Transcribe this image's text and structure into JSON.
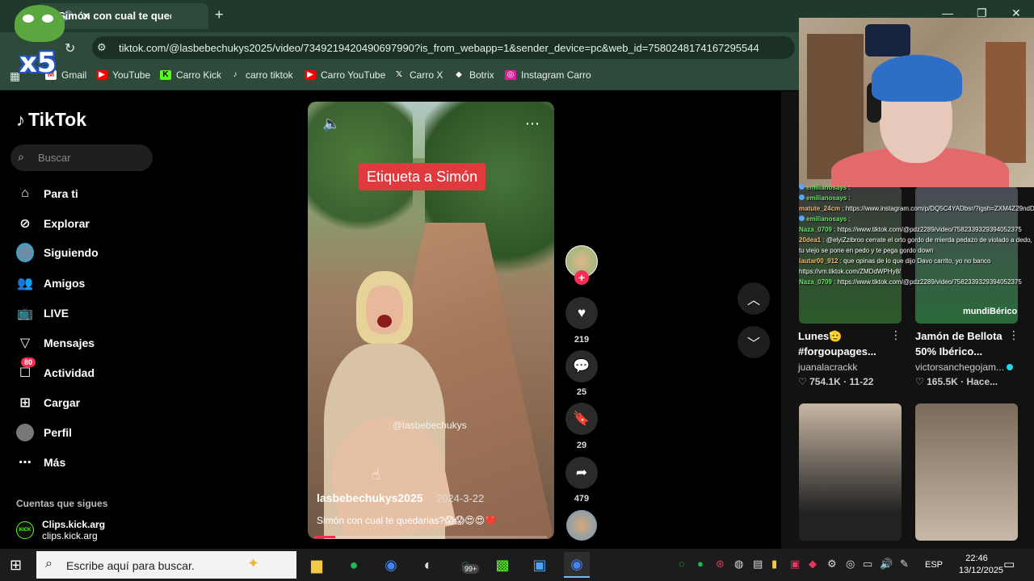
{
  "browser": {
    "tab_title": "Simón con cual te quedaría",
    "url": "tiktok.com/@lasbebechukys2025/video/7349219420490697990?is_from_webapp=1&sender_device=pc&web_id=7580248174167295544",
    "bookmarks": [
      "Gmail",
      "YouTube",
      "Carro Kick",
      "carro tiktok",
      "Carro YouTube",
      "Carro X",
      "Botrix",
      "Instagram Carro"
    ]
  },
  "overlay": {
    "emote_multiplier": "x5"
  },
  "tiktok": {
    "logo": "TikTok",
    "search_placeholder": "Buscar",
    "nav": [
      {
        "label": "Para ti",
        "icon": "home-icon"
      },
      {
        "label": "Explorar",
        "icon": "compass-icon"
      },
      {
        "label": "Siguiendo",
        "icon": "avatar"
      },
      {
        "label": "Amigos",
        "icon": "friends-icon"
      },
      {
        "label": "LIVE",
        "icon": "live-icon"
      },
      {
        "label": "Mensajes",
        "icon": "message-icon"
      },
      {
        "label": "Actividad",
        "icon": "inbox-icon"
      },
      {
        "label": "Cargar",
        "icon": "upload-icon"
      },
      {
        "label": "Perfil",
        "icon": "avatar"
      },
      {
        "label": "Más",
        "icon": "more-icon"
      }
    ],
    "activity_badge": "80",
    "following_heading": "Cuentas que sigues",
    "following": [
      {
        "name": "Clips.kick.arg",
        "handle": "clips.kick.arg"
      }
    ]
  },
  "video": {
    "sticker": "Etiqueta a Simón",
    "watermark": "@lasbebechukys",
    "author": "lasbebechukys2025",
    "date": "· 2024-3-22",
    "caption": "Simón con cual te quedarias?😱😱😍😍❤️",
    "progress": 0.09,
    "likes": "219",
    "comments": "25",
    "saves": "29",
    "shares": "479"
  },
  "chat": [
    {
      "user": "emilianosays",
      "msg": ":"
    },
    {
      "user": "emilianosays",
      "msg": ":"
    },
    {
      "user": "matute_24cm",
      "msg": ": https://www.instagram.com/p/DQ5C4YADbsr/?igsh=ZXM4Z29ndDV2NnB3"
    },
    {
      "user": "emilianosays",
      "msg": ":"
    },
    {
      "user": "Naza_0709",
      "msg": ": https://www.tiktok.com/@pdz2289/video/7582339329394052375"
    },
    {
      "user": "20dea1",
      "msg": ": @elyiZzibroo cerrate el orto gordo de mierda pedazo de violado a dedo, tu viejo se pone en pedo y te pega gordo down"
    },
    {
      "user": "lautar00_912",
      "msg": ": que opinas de lo que dijo Davo carrito, yo no banco https://vm.tiktok.com/ZMDdWPHy8/"
    },
    {
      "user": "Naza_0709",
      "msg": ": https://www.tiktok.com/@pdz2289/video/7582339329394052375"
    }
  ],
  "recommended": [
    {
      "title1": "Lunes🫡",
      "title2": "#forgoupages...",
      "author": "juanalacrackk",
      "stats": "♡ 754.1K · 11-22"
    },
    {
      "title1": "Jamón de Bellota",
      "title2": "50% Ibérico...",
      "author": "victorsanchegojam...",
      "stats": "♡ 165.5K · Hace..."
    }
  ],
  "tile_brand": "mundiBérico",
  "taskbar": {
    "search_placeholder": "Escribe aquí para buscar.",
    "whatsapp_badge": "99+",
    "lang": "ESP",
    "time": "22:46",
    "date": "13/12/2025"
  }
}
